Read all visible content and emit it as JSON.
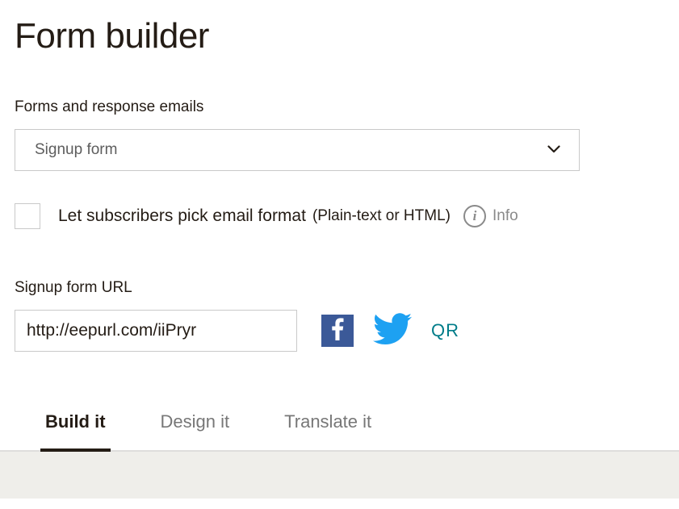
{
  "title": "Form builder",
  "forms_label": "Forms and response emails",
  "form_select_value": "Signup form",
  "checkbox_label": "Let subscribers pick email format",
  "checkbox_note": "(Plain-text or HTML)",
  "info_label": "Info",
  "url_label": "Signup form URL",
  "url_value": "http://eepurl.com/iiPryr",
  "qr_label": "QR",
  "tabs": {
    "build": "Build it",
    "design": "Design it",
    "translate": "Translate it"
  }
}
